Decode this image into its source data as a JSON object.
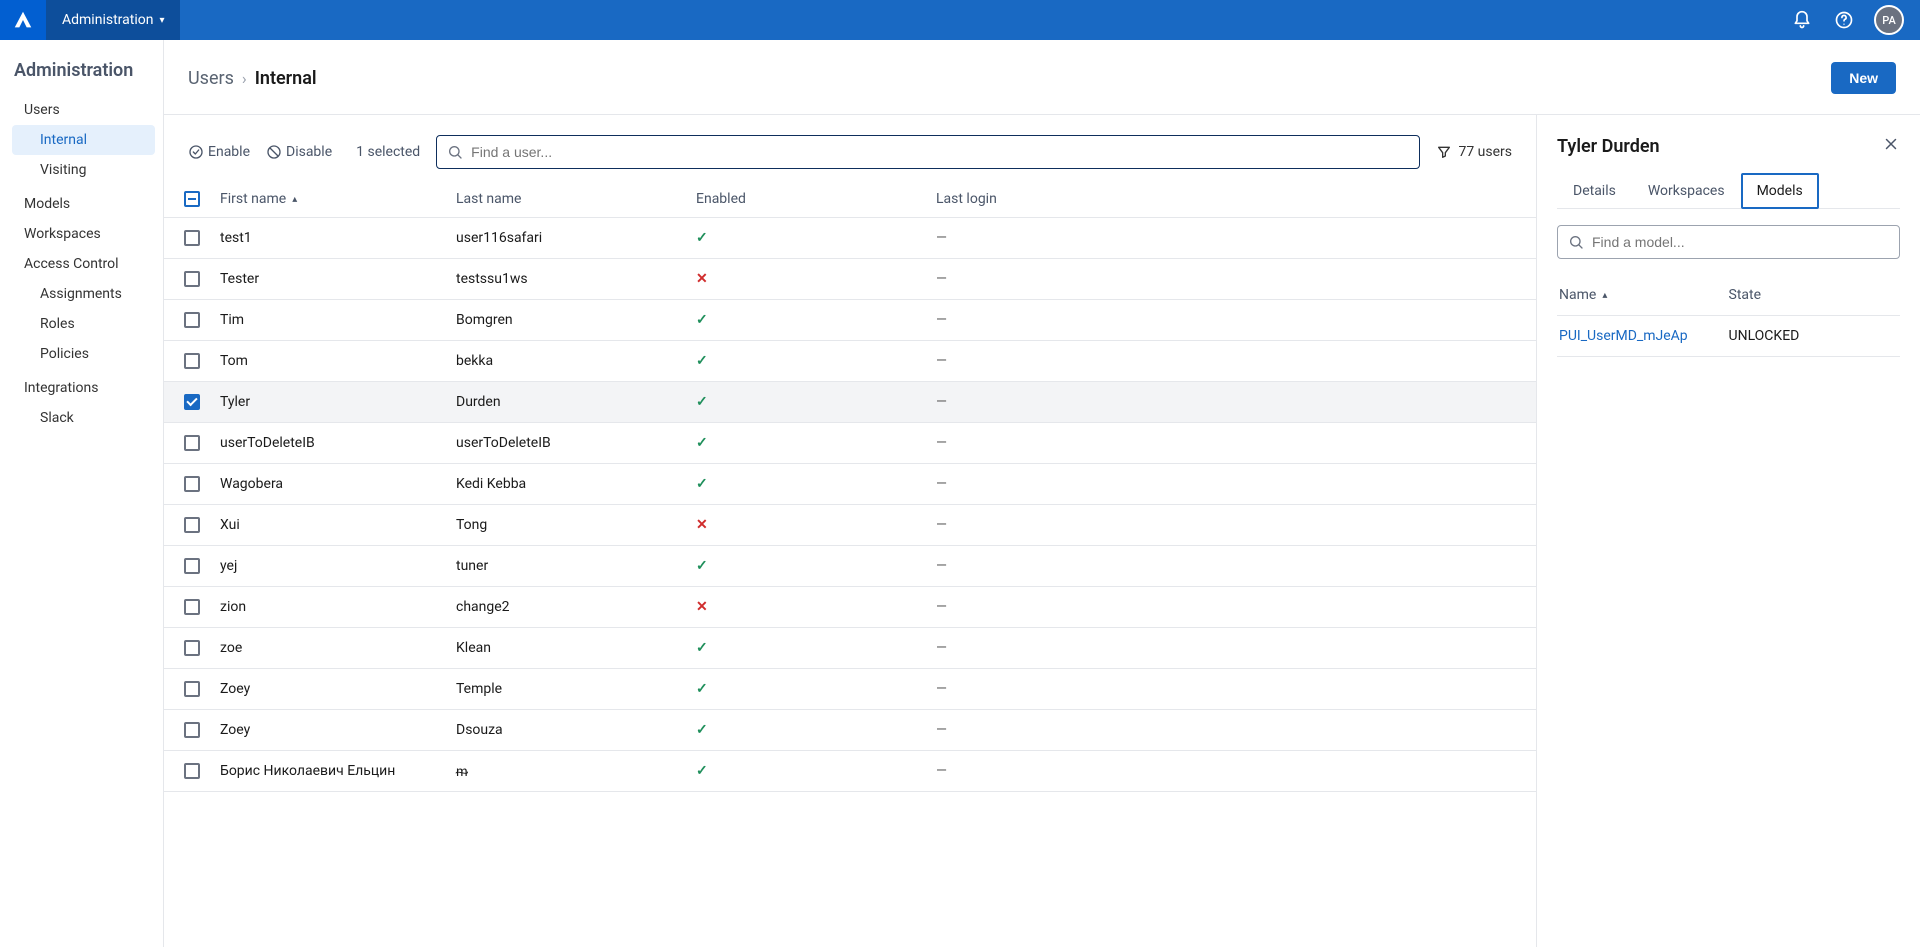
{
  "topbar": {
    "nav_label": "Administration",
    "avatar": "PA"
  },
  "sidebar": {
    "title": "Administration",
    "items": [
      {
        "label": "Users",
        "children": [
          {
            "label": "Internal",
            "active": true
          },
          {
            "label": "Visiting"
          }
        ]
      },
      {
        "label": "Models"
      },
      {
        "label": "Workspaces"
      },
      {
        "label": "Access Control",
        "children": [
          {
            "label": "Assignments"
          },
          {
            "label": "Roles"
          },
          {
            "label": "Policies"
          }
        ]
      },
      {
        "label": "Integrations",
        "children": [
          {
            "label": "Slack"
          }
        ]
      }
    ]
  },
  "breadcrumb": {
    "parent": "Users",
    "current": "Internal"
  },
  "header": {
    "new_button": "New"
  },
  "toolbar": {
    "enable_label": "Enable",
    "disable_label": "Disable",
    "selected_label": "1 selected",
    "search_placeholder": "Find a user...",
    "filter_label": "77 users"
  },
  "table": {
    "columns": [
      "First name",
      "Last name",
      "Enabled",
      "Last login"
    ],
    "rows": [
      {
        "first": "test1",
        "last": "user116safari",
        "enabled": true,
        "login": "—",
        "selected": false
      },
      {
        "first": "Tester",
        "last": "testssu1ws",
        "enabled": false,
        "login": "—",
        "selected": false
      },
      {
        "first": "Tim",
        "last": "Bomgren",
        "enabled": true,
        "login": "—",
        "selected": false
      },
      {
        "first": "Tom",
        "last": "bekka",
        "enabled": true,
        "login": "—",
        "selected": false
      },
      {
        "first": "Tyler",
        "last": "Durden",
        "enabled": true,
        "login": "—",
        "selected": true
      },
      {
        "first": "userToDeleteIB",
        "last": "userToDeleteIB",
        "enabled": true,
        "login": "—",
        "selected": false
      },
      {
        "first": "Wagobera",
        "last": "Kedi Kebba",
        "enabled": true,
        "login": "—",
        "selected": false
      },
      {
        "first": "Xui",
        "last": "Tong",
        "enabled": false,
        "login": "—",
        "selected": false
      },
      {
        "first": "yej",
        "last": "tuner",
        "enabled": true,
        "login": "—",
        "selected": false
      },
      {
        "first": "zion",
        "last": "change2",
        "enabled": false,
        "login": "—",
        "selected": false
      },
      {
        "first": "zoe",
        "last": "Klean",
        "enabled": true,
        "login": "—",
        "selected": false
      },
      {
        "first": "Zoey",
        "last": "Temple",
        "enabled": true,
        "login": "—",
        "selected": false
      },
      {
        "first": "Zoey",
        "last": "Dsouza",
        "enabled": true,
        "login": "—",
        "selected": false
      },
      {
        "first": "Борис Николаевич Ельцин",
        "last": "ᵯ",
        "enabled": true,
        "login": "—",
        "selected": false
      }
    ]
  },
  "detail": {
    "title": "Tyler Durden",
    "tabs": [
      "Details",
      "Workspaces",
      "Models"
    ],
    "active_tab": 2,
    "model_search_placeholder": "Find a model...",
    "model_columns": [
      "Name",
      "State"
    ],
    "models": [
      {
        "name": "PUI_UserMD_mJeAp",
        "state": "UNLOCKED"
      }
    ]
  }
}
